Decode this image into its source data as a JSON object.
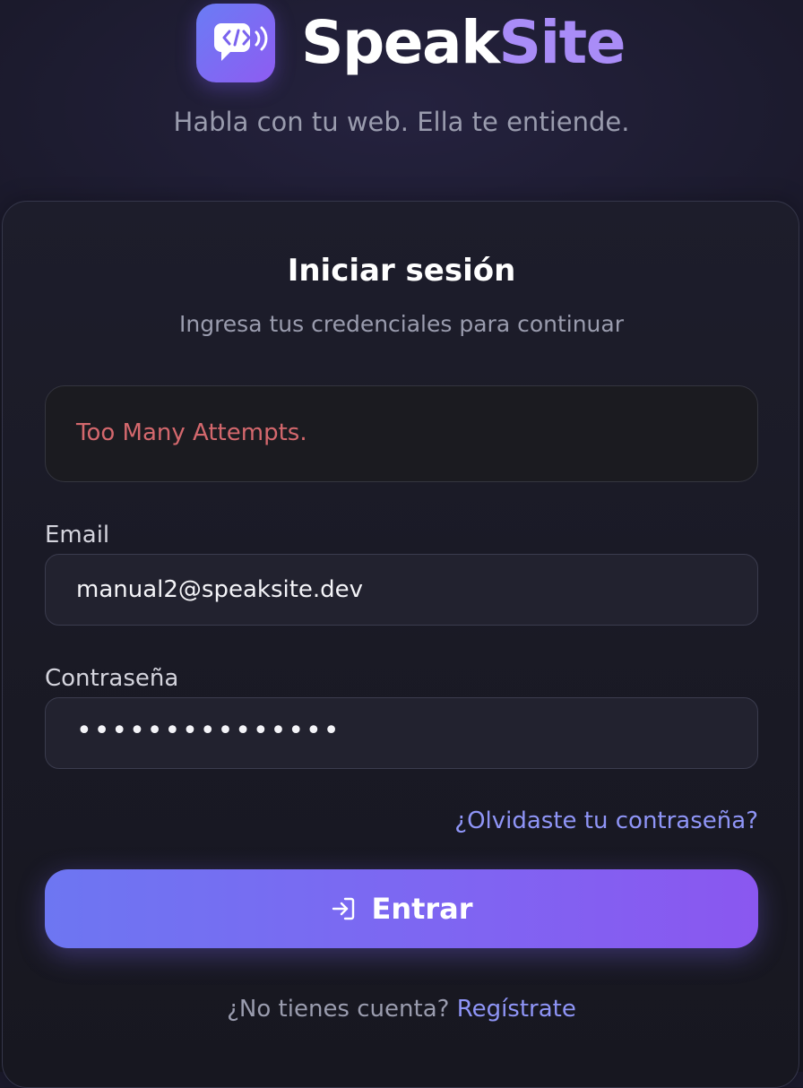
{
  "brand": {
    "name_part1": "Speak",
    "name_part2": "Site",
    "tagline": "Habla con tu web. Ella te entiende.",
    "logo_icon": "speech-bubble-code-icon"
  },
  "login": {
    "title": "Iniciar sesión",
    "subtitle": "Ingresa tus credenciales para continuar",
    "error_message": "Too Many Attempts.",
    "email": {
      "label": "Email",
      "value": "manual2@speaksite.dev"
    },
    "password": {
      "label": "Contraseña",
      "masked_value": "•••••••••••••••"
    },
    "forgot_password": "¿Olvidaste tu contraseña?",
    "submit_label": "Entrar",
    "submit_icon": "login-arrow-icon",
    "no_account_text": "¿No tienes cuenta?",
    "register_link": "Regístrate"
  },
  "colors": {
    "accent": "#8f95f7",
    "brand_purple": "#a98cf7",
    "error": "#d4686d",
    "button_gradient_start": "#6d76f2",
    "button_gradient_end": "#8a57f0",
    "background": "#1b1a2c"
  }
}
